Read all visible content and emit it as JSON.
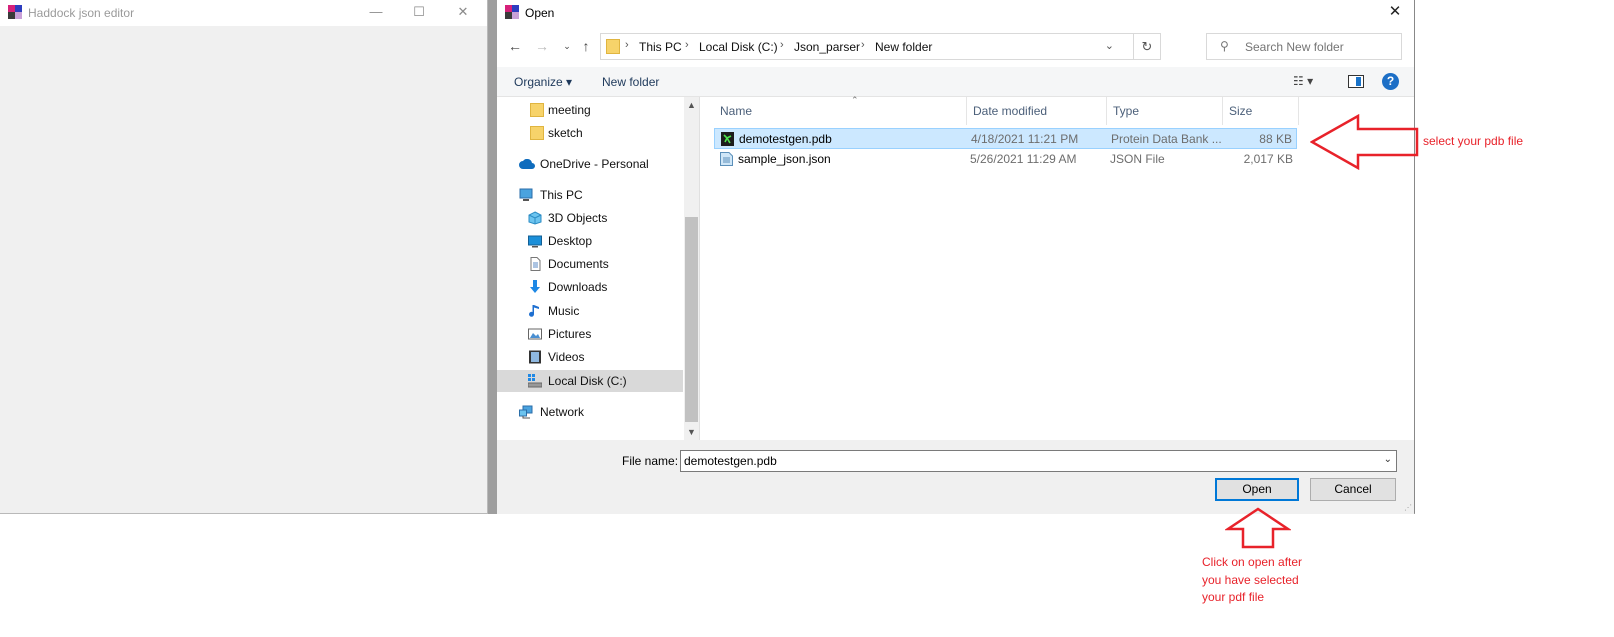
{
  "background_window": {
    "title": "Haddock json editor"
  },
  "dialog": {
    "title": "Open",
    "close_glyph": "✕",
    "breadcrumb": [
      "This PC",
      "Local Disk (C:)",
      "Json_parser",
      "New folder"
    ],
    "search_placeholder": "Search New folder",
    "toolbar": {
      "organize": "Organize ▾",
      "new_folder": "New folder",
      "help": "?"
    },
    "tree": [
      {
        "label": "meeting",
        "icon": "folder-icon",
        "indent": 2
      },
      {
        "label": "sketch",
        "icon": "folder-icon",
        "indent": 2
      },
      {
        "label": "OneDrive - Personal",
        "icon": "cloud-icon",
        "indent": 1
      },
      {
        "label": "This PC",
        "icon": "computer-icon",
        "indent": 1
      },
      {
        "label": "3D Objects",
        "icon": "cube-icon",
        "indent": 2
      },
      {
        "label": "Desktop",
        "icon": "desktop-icon",
        "indent": 2
      },
      {
        "label": "Documents",
        "icon": "document-icon",
        "indent": 2
      },
      {
        "label": "Downloads",
        "icon": "download-icon",
        "indent": 2
      },
      {
        "label": "Music",
        "icon": "music-icon",
        "indent": 2
      },
      {
        "label": "Pictures",
        "icon": "picture-icon",
        "indent": 2
      },
      {
        "label": "Videos",
        "icon": "video-icon",
        "indent": 2
      },
      {
        "label": "Local Disk (C:)",
        "icon": "drive-icon",
        "indent": 2,
        "selected": true
      },
      {
        "label": "Network",
        "icon": "network-icon",
        "indent": 1
      }
    ],
    "columns": {
      "name": "Name",
      "date": "Date modified",
      "type": "Type",
      "size": "Size"
    },
    "files": [
      {
        "name": "demotestgen.pdb",
        "date": "4/18/2021 11:21 PM",
        "type": "Protein Data Bank ...",
        "size": "88 KB",
        "selected": true
      },
      {
        "name": "sample_json.json",
        "date": "5/26/2021 11:29 AM",
        "type": "JSON File",
        "size": "2,017 KB",
        "selected": false
      }
    ],
    "file_name_label": "File name:",
    "file_name_value": "demotestgen.pdb",
    "open_label": "Open",
    "cancel_label": "Cancel"
  },
  "annotations": {
    "select_hint": "select your pdb file",
    "open_hint": [
      "Click on open after",
      "you have selected",
      "your pdf file"
    ],
    "color": "#e8222a"
  }
}
